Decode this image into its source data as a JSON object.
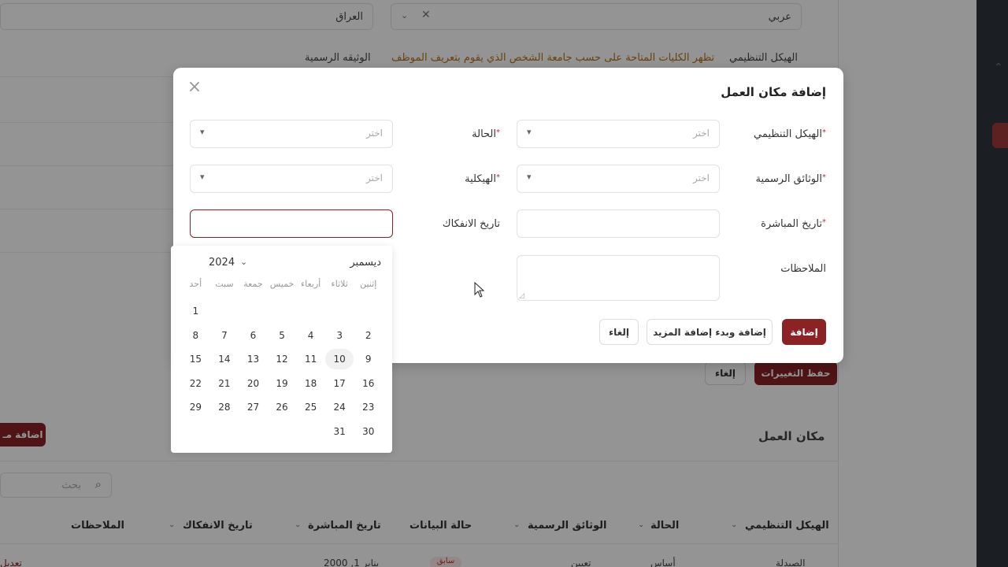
{
  "background": {
    "top_fields": {
      "language": "عربي",
      "country": "العراق"
    },
    "labels": {
      "org_structure": "الهيكل التنظيمي",
      "org_hint": "تظهر الكليات المتاحة على حسب جامعة الشخص الذي يقوم بتعريف الموظف",
      "official_doc": "الوثيقه الرسمية"
    },
    "save_changes": "حفظ التغييرات",
    "cancel": "إلغاء",
    "section_title": "مكان العمل",
    "add_button": "اضافة مـ",
    "search_placeholder": "بحث",
    "table_headers": [
      "الهيكل التنظيمي",
      "الحالة",
      "الوثائق الرسمية",
      "حالة البيانات",
      "تاريخ المباشرة",
      "تاريخ الانفكاك",
      "الملاحظات"
    ],
    "row": {
      "c1": "الصيدلة",
      "c2": "أساس",
      "c3": "تعيين",
      "c4": "سابق",
      "c5": "يناير 1, 2000",
      "edit": "تعديل"
    }
  },
  "modal": {
    "title": "إضافة مكان العمل",
    "fields": {
      "org_structure": {
        "label": "الهيكل التنظيمي",
        "placeholder": "اختر"
      },
      "status": {
        "label": "الحالة",
        "placeholder": "اختر"
      },
      "official_docs": {
        "label": "الوثائق الرسمية",
        "placeholder": "اختر"
      },
      "structure": {
        "label": "الهيكلية",
        "placeholder": "اختر"
      },
      "start_date": {
        "label": "تاريخ المباشرة"
      },
      "end_date": {
        "label": "تاريخ الانفكاك"
      },
      "notes": {
        "label": "الملاحظات"
      }
    },
    "buttons": {
      "add": "إضافة",
      "add_more": "إضافة وبدء إضافة المزيد",
      "cancel": "إلغاء"
    }
  },
  "calendar": {
    "month": "ديسمبر",
    "year": "2024",
    "weekdays": [
      "إثنين",
      "ثلاثاء",
      "أربعاء",
      "خميس",
      "جمعة",
      "سبت",
      "أحد"
    ],
    "weeks": [
      [
        "",
        "",
        "",
        "",
        "",
        "",
        "1"
      ],
      [
        "2",
        "3",
        "4",
        "5",
        "6",
        "7",
        "8"
      ],
      [
        "9",
        "10",
        "11",
        "12",
        "13",
        "14",
        "15"
      ],
      [
        "16",
        "17",
        "18",
        "19",
        "20",
        "21",
        "22"
      ],
      [
        "23",
        "24",
        "25",
        "26",
        "27",
        "28",
        "29"
      ],
      [
        "30",
        "31",
        "",
        "",
        "",
        "",
        ""
      ]
    ],
    "today": "10"
  },
  "colors": {
    "accent": "#8b2226",
    "hint": "#b5731a",
    "sidebar": "#30343b"
  }
}
